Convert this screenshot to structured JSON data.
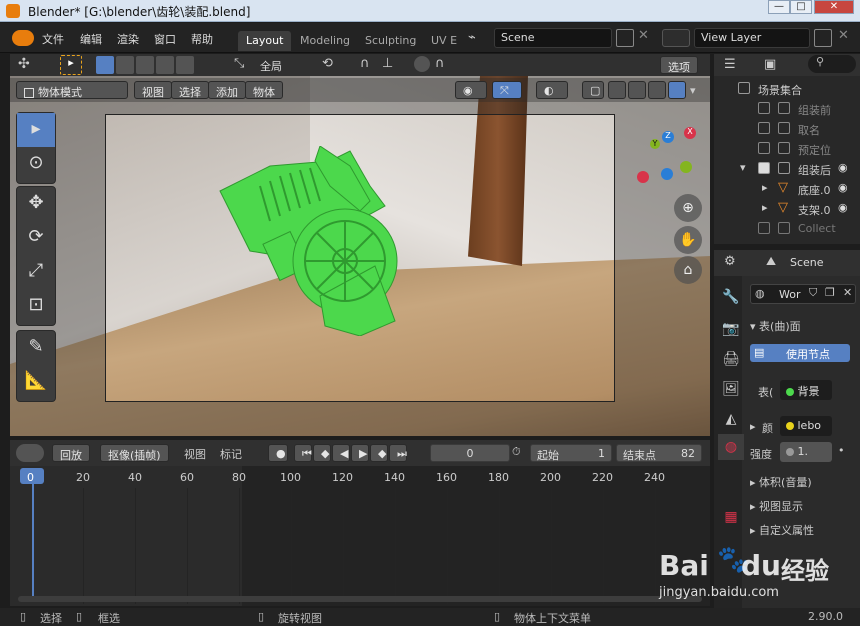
{
  "window": {
    "title": "Blender* [G:\\blender\\齿轮\\装配.blend]",
    "minimize": "—",
    "maximize": "□",
    "close": "✕"
  },
  "menubar": {
    "items": [
      "文件",
      "编辑",
      "渲染",
      "窗口",
      "帮助"
    ],
    "workspaces": [
      "Layout",
      "Modeling",
      "Sculpting",
      "UV E"
    ],
    "active_workspace": "Layout",
    "scene": "Scene",
    "view_layer": "View Layer"
  },
  "toolheader": {
    "orientation": "全局",
    "options": "选项"
  },
  "viewheader": {
    "mode": "物体模式",
    "items": [
      "视图",
      "选择",
      "添加",
      "物体"
    ]
  },
  "gizmo": {
    "y": "Y",
    "z": "Z",
    "x": "X"
  },
  "timeline_header": {
    "playback": "回放",
    "keying": "抠像(插帧)",
    "view": "视图",
    "marker": "标记",
    "current_frame": "0",
    "start_label": "起始",
    "start": "1",
    "end_label": "结束点",
    "end": "82"
  },
  "timeline": {
    "ticks": [
      "0",
      "20",
      "40",
      "60",
      "80",
      "100",
      "120",
      "140",
      "160",
      "180",
      "200",
      "220",
      "240"
    ],
    "current": "0"
  },
  "statusbar": {
    "select": "选择",
    "box_select": "框选",
    "rotate_view": "旋转视图",
    "context_menu": "物体上下文菜单",
    "version": "2.90.0"
  },
  "outliner": {
    "root": "场景集合",
    "items": [
      {
        "label": "组装前"
      },
      {
        "label": "取名"
      },
      {
        "label": "预定位"
      },
      {
        "label": "组装后"
      },
      {
        "label": "底座.0"
      },
      {
        "label": "支架.0"
      },
      {
        "label": "Collect"
      }
    ]
  },
  "properties": {
    "scene_label": "Scene",
    "world_name": "Wor",
    "surface_panel": "表(曲)面",
    "use_nodes": "使用节点",
    "surface_label": "表(",
    "surface_value": "背景",
    "color_label": "颜",
    "color_value": "lebo",
    "strength_label": "强度",
    "strength_value": "1.",
    "volume_panel": "体积(音量)",
    "viewport_display": "视图显示",
    "custom_props": "自定义属性"
  },
  "watermark": {
    "brand": "Bai",
    "brand2": "du",
    "brand_cn": "经验",
    "url": "jingyan.baidu.com"
  },
  "colors": {
    "accent": "#5680c2",
    "object_green": "#4cd84c",
    "x_axis": "#d8334a",
    "y_axis": "#84b51f",
    "z_axis": "#2a7ed6"
  }
}
